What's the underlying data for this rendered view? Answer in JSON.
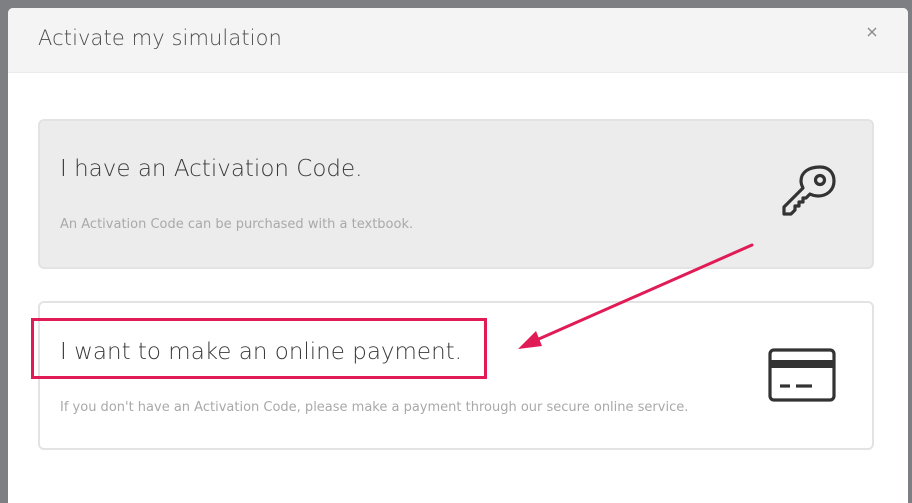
{
  "modal": {
    "title": "Activate my simulation",
    "close_icon": "close-icon"
  },
  "options": [
    {
      "title": "I have an Activation Code.",
      "description": "An Activation Code can be purchased with a textbook.",
      "icon": "key-icon"
    },
    {
      "title": "I want to make an online payment.",
      "description": "If you don't have an Activation Code, please make a payment through our secure online service.",
      "icon": "credit-card-icon"
    }
  ],
  "annotation": {
    "highlight_color": "#e01b56",
    "arrow_color": "#e01b56"
  }
}
